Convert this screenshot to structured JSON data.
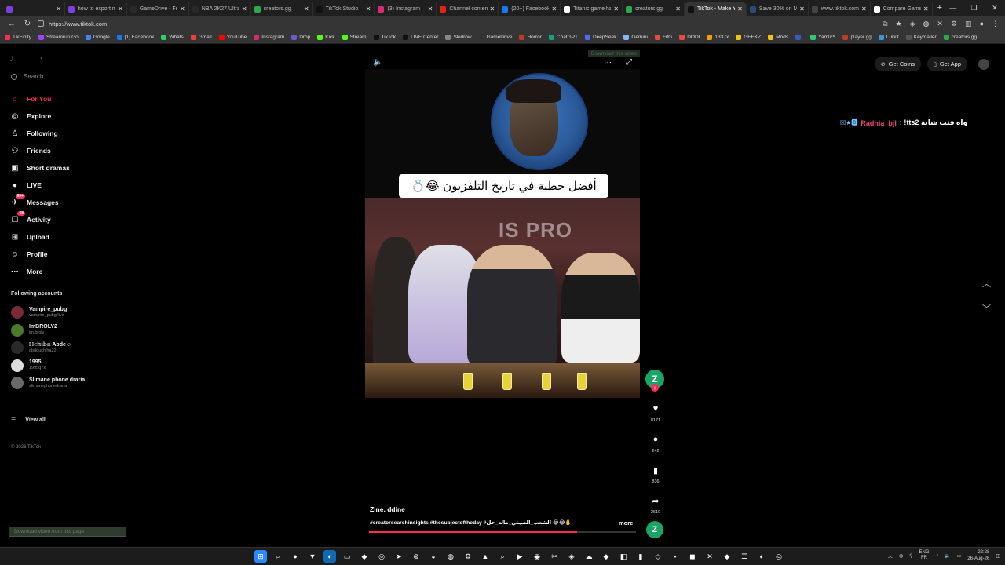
{
  "browser": {
    "tabs": [
      {
        "label": "",
        "color": "#7b3fe4"
      },
      {
        "label": "how to export my",
        "color": "#7b3fe4"
      },
      {
        "label": "GameDrive - Free",
        "color": "#2a2a2a"
      },
      {
        "label": "NBA 2K27 Ultra Ed",
        "color": "#2a2a2a"
      },
      {
        "label": "creators.gg",
        "color": "#2ea84a"
      },
      {
        "label": "TikTok Studio",
        "color": "#111111"
      },
      {
        "label": "(3) Instagram",
        "color": "#d62976"
      },
      {
        "label": "Channel content -",
        "color": "#e62117"
      },
      {
        "label": "(20+) Facebook",
        "color": "#1877f2"
      },
      {
        "label": "Titanic game hasht",
        "color": "#ffffff"
      },
      {
        "label": "creators.gg",
        "color": "#2ea84a"
      },
      {
        "label": "TikTok - Make Your",
        "color": "#111111",
        "active": true
      },
      {
        "label": "Save 30% on Moo",
        "color": "#2a4a7a"
      },
      {
        "label": "www.tiktok.com",
        "color": "#444444"
      },
      {
        "label": "Compare Gaming",
        "color": "#ffffff"
      }
    ],
    "new_tab": "+",
    "url": "https://www.tiktok.com",
    "bookmarks": [
      {
        "label": "TikFinity",
        "color": "#fe2c55"
      },
      {
        "label": "Streamrun Go",
        "color": "#a040ff"
      },
      {
        "label": "Google",
        "color": "#4285f4"
      },
      {
        "label": "[1] Facebook",
        "color": "#1877f2"
      },
      {
        "label": "Whats",
        "color": "#25d366"
      },
      {
        "label": "Gmail",
        "color": "#ea4335"
      },
      {
        "label": "YouTube",
        "color": "#ff0000"
      },
      {
        "label": "Instagram",
        "color": "#d62976"
      },
      {
        "label": "Drop",
        "color": "#6a5acd"
      },
      {
        "label": "Kick",
        "color": "#53fc18"
      },
      {
        "label": "Stream",
        "color": "#53fc18"
      },
      {
        "label": "TikTok",
        "color": "#111111"
      },
      {
        "label": "LIVE Center",
        "color": "#111111"
      },
      {
        "label": "Skidrow",
        "color": "#888888"
      },
      {
        "label": "GameDrive",
        "color": "#333333"
      },
      {
        "label": "Horror",
        "color": "#c0392b"
      },
      {
        "label": "ChatGPT",
        "color": "#10a37f"
      },
      {
        "label": "DeepSeek",
        "color": "#4d6bfe"
      },
      {
        "label": "Gemini",
        "color": "#8ab4f8"
      },
      {
        "label": "FitG",
        "color": "#e74c3c"
      },
      {
        "label": "DODI",
        "color": "#e74c3c"
      },
      {
        "label": "1337x",
        "color": "#f39c12"
      },
      {
        "label": "GEEKZ",
        "color": "#f1c40f"
      },
      {
        "label": "Mods",
        "color": "#f1c40f"
      },
      {
        "label": "",
        "color": "#3a5ac0"
      },
      {
        "label": "Yamli™",
        "color": "#2ecc71"
      },
      {
        "label": "player.gg",
        "color": "#c0392b"
      },
      {
        "label": "Lurkit",
        "color": "#3498db"
      },
      {
        "label": "Keymailer",
        "color": "#555555"
      },
      {
        "label": "creators.gg",
        "color": "#2ea84a"
      }
    ]
  },
  "sidebar": {
    "search_placeholder": "Search",
    "nav": [
      {
        "label": "For You",
        "icon": "home-icon",
        "glyph": "⌂",
        "active": true
      },
      {
        "label": "Explore",
        "icon": "compass-icon",
        "glyph": "◎"
      },
      {
        "label": "Following",
        "icon": "following-icon",
        "glyph": "♙"
      },
      {
        "label": "Friends",
        "icon": "friends-icon",
        "glyph": "⚇"
      },
      {
        "label": "Short dramas",
        "icon": "film-icon",
        "glyph": "▣"
      },
      {
        "label": "LIVE",
        "icon": "live-icon",
        "glyph": "●"
      },
      {
        "label": "Messages",
        "icon": "messages-icon",
        "glyph": "✈",
        "badge": "99+"
      },
      {
        "label": "Activity",
        "icon": "activity-icon",
        "glyph": "☐",
        "badge": "68"
      },
      {
        "label": "Upload",
        "icon": "upload-icon",
        "glyph": "⊞"
      },
      {
        "label": "Profile",
        "icon": "profile-icon",
        "glyph": "☺"
      },
      {
        "label": "More",
        "icon": "more-icon",
        "glyph": "···"
      }
    ],
    "following_heading": "Following accounts",
    "accounts": [
      {
        "name": "Vampire_pubg",
        "handle": "vampire_pubg.live",
        "color": "#7a2a3a"
      },
      {
        "name": "ImBROLY2",
        "handle": "im.broly",
        "color": "#4a7a2a"
      },
      {
        "name": "ℍ𝕔𝕙𝕚𝕓𝕒 Abde☺",
        "handle": "abdouchiha22",
        "color": "#2a2a2a"
      },
      {
        "name": "1995",
        "handle": "1995q7x",
        "color": "#dddddd"
      },
      {
        "name": "Slimane phone draria",
        "handle": "slimanephonedraria",
        "color": "#6a6a6a"
      }
    ],
    "view_all": "View all",
    "copyright": "© 2026 TikTok",
    "download_page": "Download video from this page"
  },
  "player": {
    "download_video": "Download this video",
    "caption": "أفضل خطبة في تاريخ التلفزيون 😂💍",
    "watermark": "IS PRO",
    "author": "Zine. ddine",
    "description": "#creatorsearchinsights #thesubjectoftheday #الشعب_الصيني_ماله_حل 😂😂✋ ...",
    "more": "more",
    "progress": 0.78,
    "actions": {
      "avatar_letter": "Z",
      "likes": "8171",
      "comments": "242",
      "saves": "836",
      "shares": "2610"
    }
  },
  "header": {
    "get_coins": "Get Coins",
    "get_app": "Get App"
  },
  "live_comment": {
    "emoji": "☒★🅱",
    "name": "Radhia_bjl",
    "text": ": !tts2 واه فتت شابة"
  },
  "taskbar": {
    "lang_top": "ENG",
    "lang_bottom": "FR",
    "time": "22:28",
    "date": "26-Aug-26",
    "apps": [
      {
        "icon": "windows-start-icon",
        "glyph": "⊞",
        "color": "#2b88ff"
      },
      {
        "icon": "search-icon",
        "glyph": "⌕",
        "color": "#1c1c1c"
      },
      {
        "icon": "chrome-icon",
        "glyph": "●",
        "color": "#1c1c1c"
      },
      {
        "icon": "brave-icon",
        "glyph": "▼",
        "color": "#1c1c1c"
      },
      {
        "icon": "edge-icon",
        "glyph": "◐",
        "color": "#0f6ab4"
      },
      {
        "icon": "file-explorer-icon",
        "glyph": "▭",
        "color": "#1c1c1c"
      },
      {
        "icon": "store-icon",
        "glyph": "◆",
        "color": "#1c1c1c"
      },
      {
        "icon": "browser-icon",
        "glyph": "◎",
        "color": "#1c1c1c"
      },
      {
        "icon": "steam-icon",
        "glyph": "➤",
        "color": "#1c1c1c"
      },
      {
        "icon": "xbox-icon",
        "glyph": "⊗",
        "color": "#1c1c1c"
      },
      {
        "icon": "discord-icon",
        "glyph": "◒",
        "color": "#1c1c1c"
      },
      {
        "icon": "github-icon",
        "glyph": "◍",
        "color": "#1c1c1c"
      },
      {
        "icon": "settings-icon",
        "glyph": "⚙",
        "color": "#1c1c1c"
      },
      {
        "icon": "epic-icon",
        "glyph": "▲",
        "color": "#1c1c1c"
      },
      {
        "icon": "search2-icon",
        "glyph": "⌕",
        "color": "#1c1c1c"
      },
      {
        "icon": "media-icon",
        "glyph": "▶",
        "color": "#1c1c1c"
      },
      {
        "icon": "obs-icon",
        "glyph": "◉",
        "color": "#1c1c1c"
      },
      {
        "icon": "capcut-icon",
        "glyph": "✂",
        "color": "#1c1c1c"
      },
      {
        "icon": "ubisoft-icon",
        "glyph": "◈",
        "color": "#1c1c1c"
      },
      {
        "icon": "cloud-icon",
        "glyph": "☁",
        "color": "#1c1c1c"
      },
      {
        "icon": "app-icon",
        "glyph": "◆",
        "color": "#1c1c1c"
      },
      {
        "icon": "vpn-icon",
        "glyph": "◧",
        "color": "#1c1c1c"
      },
      {
        "icon": "bar-icon",
        "glyph": "▮",
        "color": "#1c1c1c"
      },
      {
        "icon": "app2-icon",
        "glyph": "◇",
        "color": "#1c1c1c"
      },
      {
        "icon": "app3-icon",
        "glyph": "▪",
        "color": "#1c1c1c"
      },
      {
        "icon": "app4-icon",
        "glyph": "◼",
        "color": "#1c1c1c"
      },
      {
        "icon": "app5-icon",
        "glyph": "✕",
        "color": "#1c1c1c"
      },
      {
        "icon": "app6-icon",
        "glyph": "◆",
        "color": "#1c1c1c"
      },
      {
        "icon": "app7-icon",
        "glyph": "☰",
        "color": "#1c1c1c"
      },
      {
        "icon": "app8-icon",
        "glyph": "◐",
        "color": "#1c1c1c"
      },
      {
        "icon": "app9-icon",
        "glyph": "◎",
        "color": "#1c1c1c"
      }
    ]
  }
}
